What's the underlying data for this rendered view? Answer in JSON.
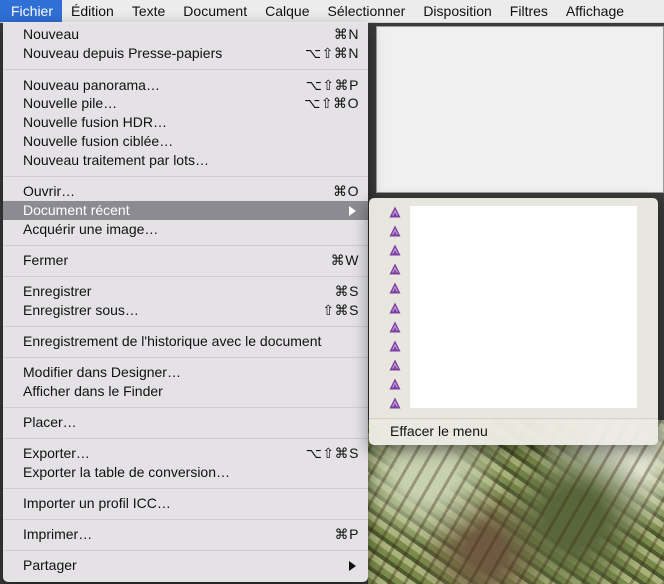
{
  "menubar": {
    "items": [
      "Fichier",
      "Édition",
      "Texte",
      "Document",
      "Calque",
      "Sélectionner",
      "Disposition",
      "Filtres",
      "Affichage"
    ]
  },
  "menu": {
    "items": [
      {
        "label": "Nouveau",
        "shortcut": "⌘N"
      },
      {
        "label": "Nouveau depuis Presse-papiers",
        "shortcut": "⌥⇧⌘N"
      },
      {
        "label": "Nouveau panorama…",
        "shortcut": "⌥⇧⌘P"
      },
      {
        "label": "Nouvelle pile…",
        "shortcut": "⌥⇧⌘O"
      },
      {
        "label": "Nouvelle fusion HDR…",
        "shortcut": ""
      },
      {
        "label": "Nouvelle fusion ciblée…",
        "shortcut": ""
      },
      {
        "label": "Nouveau traitement par lots…",
        "shortcut": ""
      },
      {
        "label": "Ouvrir…",
        "shortcut": "⌘O"
      },
      {
        "label": "Document récent",
        "shortcut": ""
      },
      {
        "label": "Acquérir une image…",
        "shortcut": ""
      },
      {
        "label": "Fermer",
        "shortcut": "⌘W"
      },
      {
        "label": "Enregistrer",
        "shortcut": "⌘S"
      },
      {
        "label": "Enregistrer sous…",
        "shortcut": "⇧⌘S"
      },
      {
        "label": "Enregistrement de l'historique avec le document",
        "shortcut": ""
      },
      {
        "label": "Modifier dans Designer…",
        "shortcut": ""
      },
      {
        "label": "Afficher dans le Finder",
        "shortcut": ""
      },
      {
        "label": "Placer…",
        "shortcut": ""
      },
      {
        "label": "Exporter…",
        "shortcut": "⌥⇧⌘S"
      },
      {
        "label": "Exporter la table de conversion…",
        "shortcut": ""
      },
      {
        "label": "Importer un profil ICC…",
        "shortcut": ""
      },
      {
        "label": "Imprimer…",
        "shortcut": "⌘P"
      },
      {
        "label": "Partager",
        "shortcut": ""
      }
    ]
  },
  "submenu": {
    "recent_initials": [
      "",
      "",
      "",
      "",
      "",
      "",
      "",
      "",
      "",
      "",
      ""
    ],
    "clear_label": "Effacer le menu",
    "icon_name": "affinity-photo-icon",
    "icon_color": "#7b3fa0"
  },
  "colors": {
    "menubar_active": "#2f6fd6",
    "menu_highlight": "#8c8b91"
  }
}
